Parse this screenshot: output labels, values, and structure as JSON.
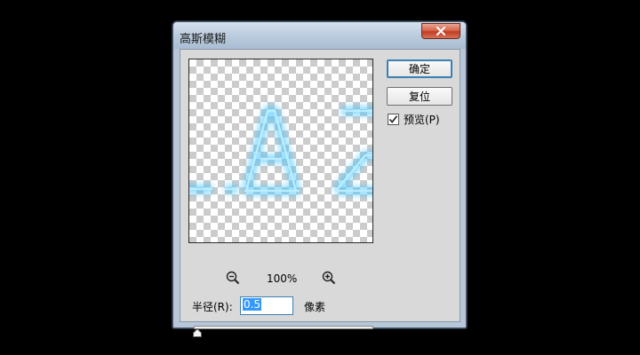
{
  "window": {
    "title": "高斯模糊"
  },
  "buttons": {
    "ok_label": "确定",
    "reset_label": "复位"
  },
  "preview_toggle": {
    "label": "预览(P)",
    "checked": true
  },
  "zoom": {
    "level": "100%"
  },
  "radius": {
    "label": "半径(R):",
    "value": "0.5",
    "unit": "像素"
  },
  "slider": {
    "fraction": 0.0
  },
  "colors": {
    "glow": "#39c3ff",
    "selection": "#3399ff",
    "close_button": "#c84a2f"
  }
}
